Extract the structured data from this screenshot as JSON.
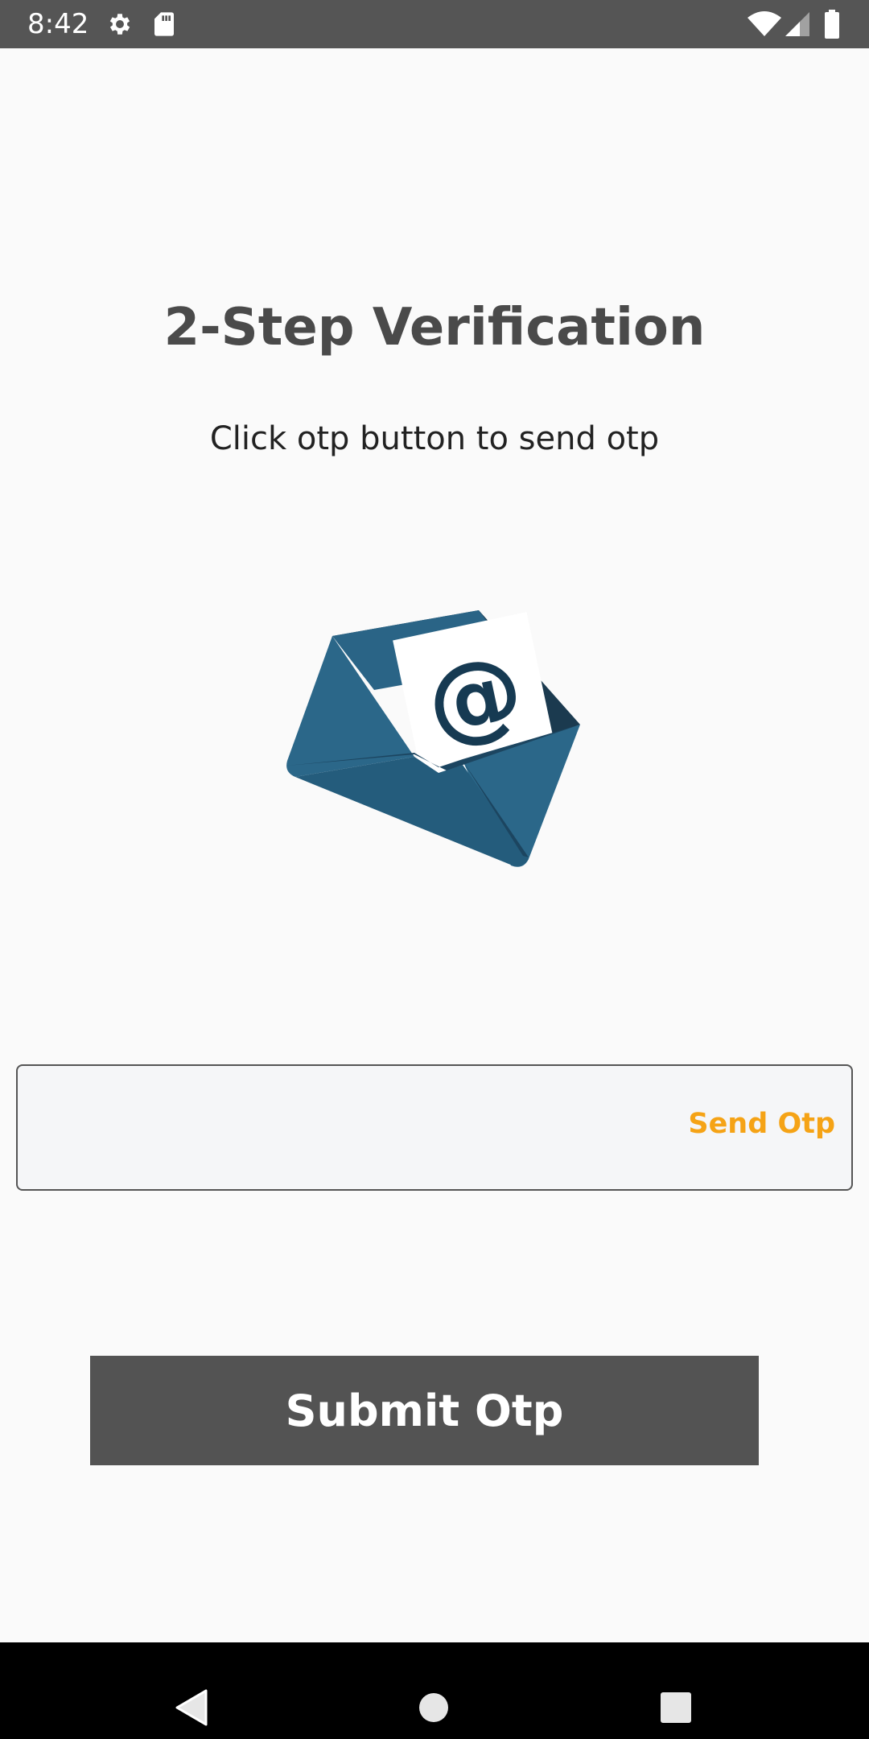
{
  "status_bar": {
    "time": "8:42",
    "icons": [
      "gear-icon",
      "sd-card-icon",
      "wifi-icon",
      "signal-icon",
      "battery-icon"
    ]
  },
  "main": {
    "title": "2-Step Verification",
    "subtitle": "Click otp button to send otp",
    "illustration": "email-envelope-icon",
    "otp_input": {
      "value": "",
      "placeholder": ""
    },
    "send_otp_label": "Send Otp",
    "submit_label": "Submit Otp"
  },
  "nav_bar": {
    "icons": [
      "back-icon",
      "home-icon",
      "recents-icon"
    ]
  },
  "colors": {
    "status_bar": "#555555",
    "title": "#4a4a4a",
    "accent_orange": "#f5a316",
    "submit_button": "#535353",
    "envelope_blue": "#2a6486"
  }
}
